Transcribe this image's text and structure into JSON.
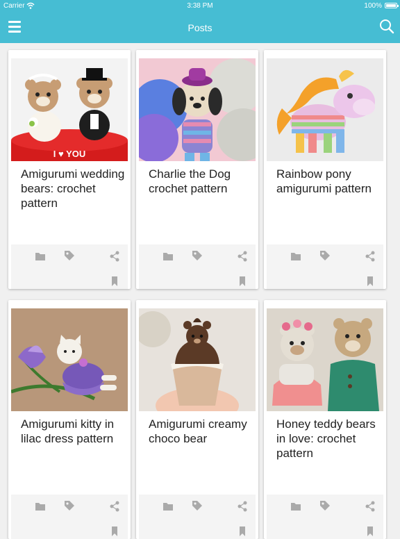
{
  "status_bar": {
    "carrier": "Carrier",
    "time": "3:38 PM",
    "battery": "100%"
  },
  "nav": {
    "title": "Posts",
    "menu_icon": "hamburger-menu-icon",
    "search_icon": "search-icon"
  },
  "colors": {
    "accent": "#46bdd3",
    "card_bg": "#ffffff",
    "action_bar_bg": "#f4f4f4",
    "icon_gray": "#aaaaaa"
  },
  "posts": [
    {
      "title": "Amigurumi wedding bears: crochet pattern",
      "image": "crochet wedding bears on red heart pillow with I love you"
    },
    {
      "title": "Charlie the Dog crochet pattern",
      "image": "crochet dog with purple hat in front of yarn balls"
    },
    {
      "title": "Rainbow pony amigurumi pattern",
      "image": "rainbow striped crochet pony"
    },
    {
      "title": "Amigurumi kitty in lilac dress pattern",
      "image": "crochet kitty in lilac dress with iris flower"
    },
    {
      "title": "Amigurumi creamy choco bear",
      "image": "crochet chocolate bear in cupcake"
    },
    {
      "title": "Honey teddy bears in love: crochet pattern",
      "image": "two crochet teddy bears in dress and coat"
    }
  ],
  "card_actions": [
    "folder-icon",
    "tag-icon",
    "share-icon",
    "bookmark-icon"
  ],
  "heart_pillow_text": "I ♥ YOU"
}
